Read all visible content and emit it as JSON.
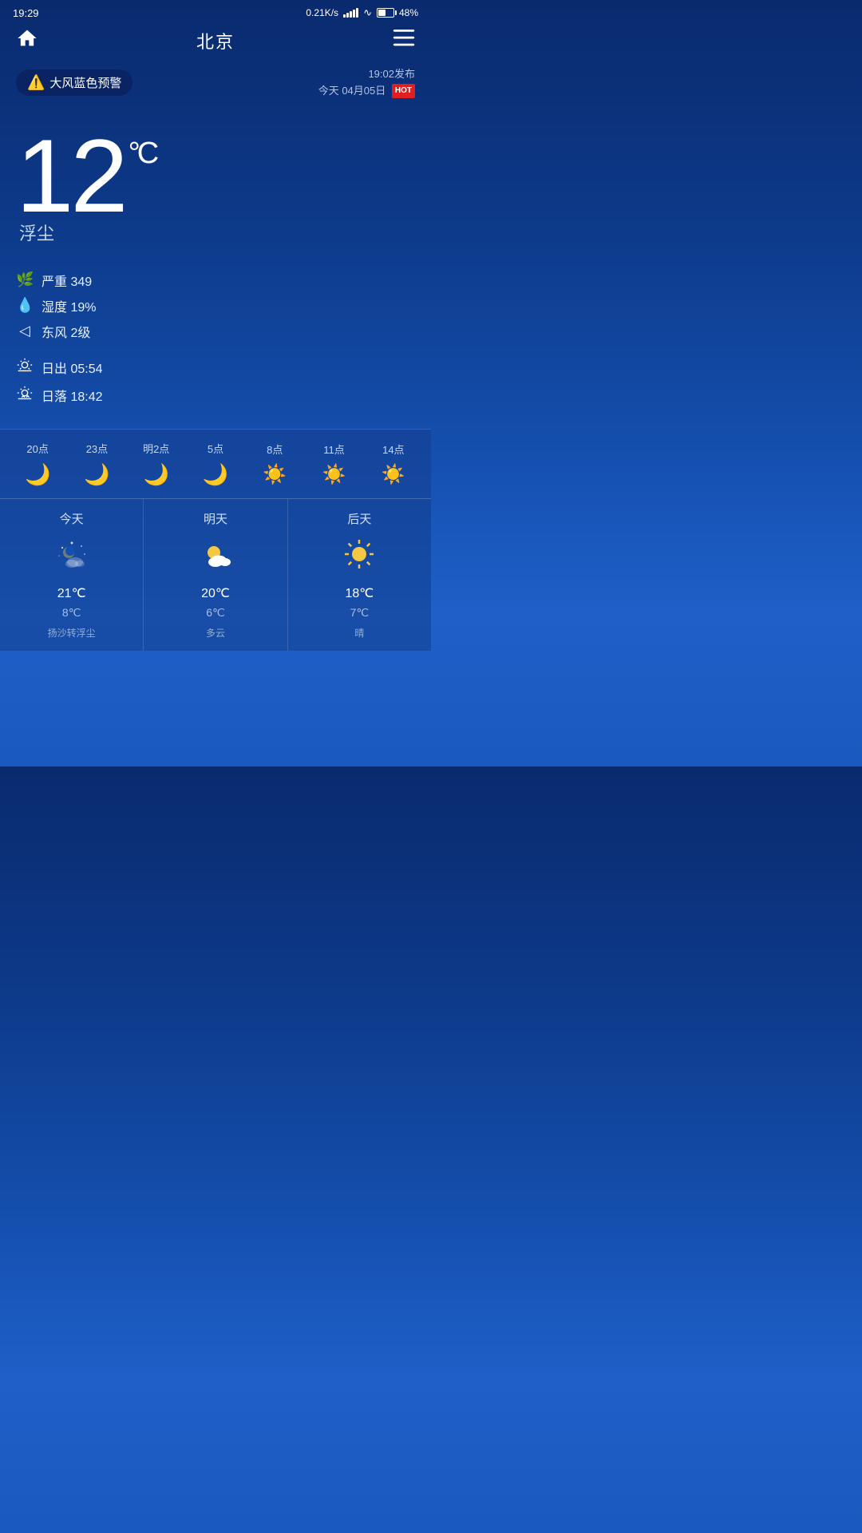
{
  "statusBar": {
    "time": "19:29",
    "network": "0.21K/s",
    "batteryPercent": "48%"
  },
  "header": {
    "homeIcon": "home",
    "title": "北京",
    "menuIcon": "menu"
  },
  "alert": {
    "icon": "⚠️",
    "label": "大风蓝色预警",
    "publishTime": "19:02发布",
    "date": "今天 04月05日",
    "hotBadge": "HOT"
  },
  "current": {
    "temperature": "12",
    "unit": "°C",
    "description": "浮尘"
  },
  "stats": {
    "aqi": {
      "label": "严重 349"
    },
    "humidity": {
      "label": "湿度 19%"
    },
    "wind": {
      "label": "东风 2级"
    },
    "sunrise": {
      "label": "日出  05:54"
    },
    "sunset": {
      "label": "日落  18:42"
    }
  },
  "hourly": [
    {
      "time": "20点",
      "icon": "moon"
    },
    {
      "time": "23点",
      "icon": "moon"
    },
    {
      "time": "明2点",
      "icon": "moon"
    },
    {
      "time": "5点",
      "icon": "moon"
    },
    {
      "time": "8点",
      "icon": "sun"
    },
    {
      "time": "11点",
      "icon": "sun"
    },
    {
      "time": "14点",
      "icon": "sun"
    }
  ],
  "daily": [
    {
      "label": "今天",
      "icon": "partly-cloudy-night",
      "high": "21℃",
      "low": "8℃",
      "desc": "扬沙转浮尘"
    },
    {
      "label": "明天",
      "icon": "partly-cloudy",
      "high": "20℃",
      "low": "6℃",
      "desc": "多云"
    },
    {
      "label": "后天",
      "icon": "sunny",
      "high": "18℃",
      "low": "7℃",
      "desc": "晴"
    }
  ]
}
